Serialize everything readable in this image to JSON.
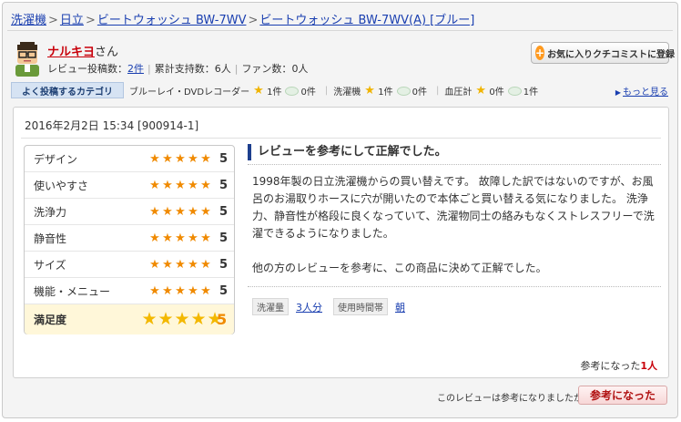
{
  "breadcrumb": {
    "items": [
      "洗濯機",
      "日立",
      "ビートウォッシュ BW-7WV"
    ],
    "current": "ビートウォッシュ BW-7WV(A) [ブルー]"
  },
  "user": {
    "name": "ナルキヨ",
    "honorific": "さん",
    "review_count_label": "レビュー投稿数：",
    "review_count": "2件",
    "support_label": "累計支持数：",
    "support_count": "6人",
    "fan_label": "ファン数：",
    "fan_count": "0人"
  },
  "fav_button": "お気に入りクチコミストに登録",
  "categories": {
    "label": "よく投稿するカテゴリ",
    "items": [
      {
        "name": "ブルーレイ・DVDレコーダー",
        "stars": "1件",
        "bubbles": "0件"
      },
      {
        "name": "洗濯機",
        "stars": "1件",
        "bubbles": "0件"
      },
      {
        "name": "血圧計",
        "stars": "0件",
        "bubbles": "1件"
      }
    ],
    "more": "もっと見る"
  },
  "review": {
    "date": "2016年2月2日  15:34 [900914-1]",
    "title": "レビューを参考にして正解でした。",
    "body": [
      "1998年製の日立洗濯機からの買い替えです。 故障した訳ではないのですが、お風呂のお湯取りホースに穴が開いたので本体ごと買い替える気になりました。 洗浄力、静音性が格段に良くなっていて、洗濯物同士の絡みもなくストレスフリーで洗濯できるようになりました。",
      "他の方のレビューを参考に、この商品に決めて正解でした。"
    ],
    "ratings": [
      {
        "label": "デザイン",
        "value": 5
      },
      {
        "label": "使いやすさ",
        "value": 5
      },
      {
        "label": "洗浄力",
        "value": 5
      },
      {
        "label": "静音性",
        "value": 5
      },
      {
        "label": "サイズ",
        "value": 5
      },
      {
        "label": "機能・メニュー",
        "value": 5
      }
    ],
    "total": {
      "label": "満足度",
      "value": 5
    },
    "tags": [
      {
        "label": "洗濯量",
        "value": "3人分"
      },
      {
        "label": "使用時間帯",
        "value": "朝"
      }
    ],
    "helpful_prefix": "参考になった",
    "helpful_count": "1人"
  },
  "footer": {
    "question": "このレビューは参考になりましたか？",
    "button": "参考になった"
  }
}
